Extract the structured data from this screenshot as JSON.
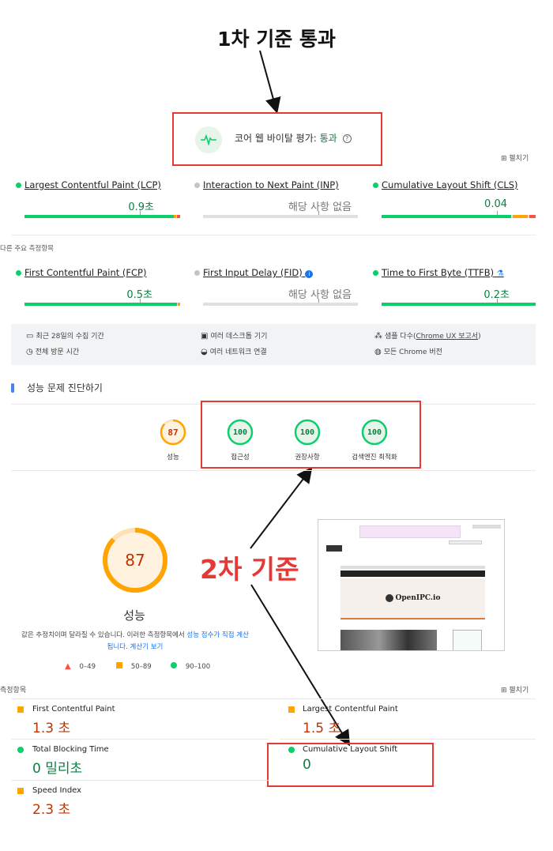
{
  "annotations": {
    "title1": "1차 기준 통과",
    "title2": "2차 기준"
  },
  "cwv": {
    "assessment_label": "코어 웹 바이탈 평가:",
    "assessment_value": "통과",
    "expand_label": "펼치기"
  },
  "core_metrics": [
    {
      "label": "Largest Contentful Paint (LCP)",
      "value": "0.9초",
      "status": "good",
      "fraction": 0.2
    },
    {
      "label": "Interaction to Next Paint (INP)",
      "value": "해당 사항 없음",
      "status": "na"
    },
    {
      "label": "Cumulative Layout Shift (CLS)",
      "value": "0.04",
      "status": "good",
      "fraction": 0.2
    }
  ],
  "other_heading": "다른 주요 측정항목",
  "other_metrics": [
    {
      "label": "First Contentful Paint (FCP)",
      "value": "0.5초",
      "status": "good"
    },
    {
      "label": "First Input Delay (FID)",
      "value": "해당 사항 없음",
      "status": "na"
    },
    {
      "label": "Time to First Byte (TTFB)",
      "value": "0.2초",
      "status": "good"
    }
  ],
  "info": {
    "collection_period": "최근 28일의 수집 기간",
    "desktop_devices": "여러 데스크톱 기기",
    "samples_prefix": "샘플 다수(",
    "samples_link": "Chrome UX 보고서",
    "samples_suffix": ")",
    "full_visit": "전체 방문 시간",
    "network": "여러 네트워크 연결",
    "chrome_versions": "모든 Chrome 버전"
  },
  "diagnose_heading": "성능 문제 진단하기",
  "scores": [
    {
      "value": "87",
      "label": "성능",
      "color": "#ffa400"
    },
    {
      "value": "100",
      "label": "접근성",
      "color": "#0cce6b"
    },
    {
      "value": "100",
      "label": "권장사항",
      "color": "#0cce6b"
    },
    {
      "value": "100",
      "label": "검색엔진 최적화",
      "color": "#0cce6b"
    }
  ],
  "performance": {
    "score": "87",
    "label": "성능",
    "note_text": "값은 추정치이며 달라질 수 있습니다. 이러한 측정항목에서 ",
    "note_link1": "성능 점수가 직접 계산됩니다",
    "note_mid": ". ",
    "note_link2": "계산기 보기"
  },
  "legend": [
    {
      "range": "0–49",
      "color": "#ff4e42"
    },
    {
      "range": "50–89",
      "color": "#ffa400"
    },
    {
      "range": "90–100",
      "color": "#0cce6b"
    }
  ],
  "screenshot": {
    "logo_text": "OpenIPC.io"
  },
  "lab": {
    "heading": "측정항목",
    "expand_label": "펼치기",
    "metrics": [
      {
        "name": "First Contentful Paint",
        "value": "1.3 초",
        "status": "average"
      },
      {
        "name": "Largest Contentful Paint",
        "value": "1.5 초",
        "status": "average"
      },
      {
        "name": "Total Blocking Time",
        "value": "0 밀리초",
        "status": "good"
      },
      {
        "name": "Cumulative Layout Shift",
        "value": "0",
        "status": "good"
      },
      {
        "name": "Speed Index",
        "value": "2.3 초",
        "status": "average"
      }
    ]
  }
}
